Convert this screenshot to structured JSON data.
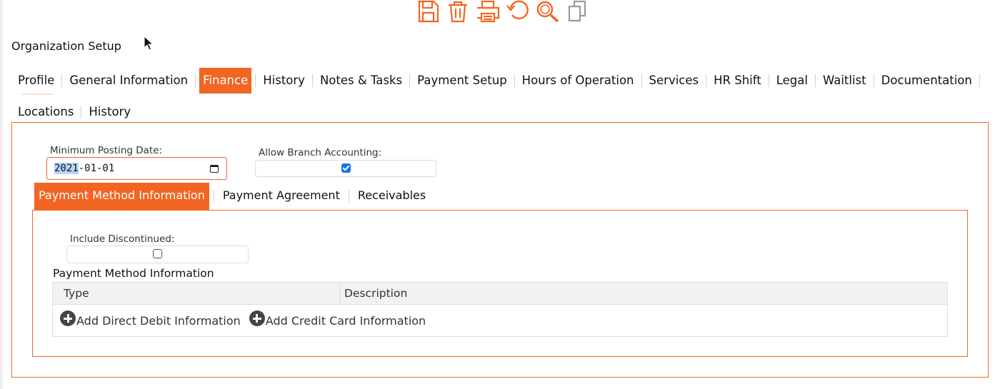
{
  "toolbar": {
    "icons": [
      "save-icon",
      "delete-icon",
      "print-icon",
      "undo-icon",
      "search-icon",
      "copy-icon"
    ],
    "accent_color": "#f26522",
    "disabled_color": "#9b9b9b"
  },
  "page": {
    "title": "Organization Setup"
  },
  "main_tabs": [
    {
      "label": "Profile",
      "active": false
    },
    {
      "label": "General Information",
      "active": false
    },
    {
      "label": "Finance",
      "active": true
    },
    {
      "label": "History",
      "active": false
    },
    {
      "label": "Notes & Tasks",
      "active": false
    },
    {
      "label": "Payment Setup",
      "active": false
    },
    {
      "label": "Hours of Operation",
      "active": false
    },
    {
      "label": "Services",
      "active": false
    },
    {
      "label": "HR Shift",
      "active": false
    },
    {
      "label": "Legal",
      "active": false
    },
    {
      "label": "Waitlist",
      "active": false
    },
    {
      "label": "Documentation",
      "active": false
    },
    {
      "label": "Locations",
      "active": false
    },
    {
      "label": "History",
      "active": false
    }
  ],
  "finance": {
    "min_posting_date_label": "Minimum Posting Date:",
    "min_posting_date_selected": "2021",
    "min_posting_date_rest": "-01-01",
    "allow_branch_accounting_label": "Allow Branch Accounting:",
    "allow_branch_accounting": true
  },
  "sub_tabs": [
    {
      "label": "Payment Method Information",
      "active": true
    },
    {
      "label": "Payment Agreement",
      "active": false
    },
    {
      "label": "Receivables",
      "active": false
    }
  ],
  "payment_method": {
    "include_discontinued_label": "Include Discontinued:",
    "include_discontinued": false,
    "section_heading": "Payment Method Information",
    "columns": [
      "Type",
      "Description"
    ],
    "actions": [
      "Add Direct Debit Information",
      "Add Credit Card Information"
    ]
  },
  "colors": {
    "accent": "#f26522",
    "selection": "#b4d5fe",
    "checkbox_checked": "#1a73e8"
  }
}
